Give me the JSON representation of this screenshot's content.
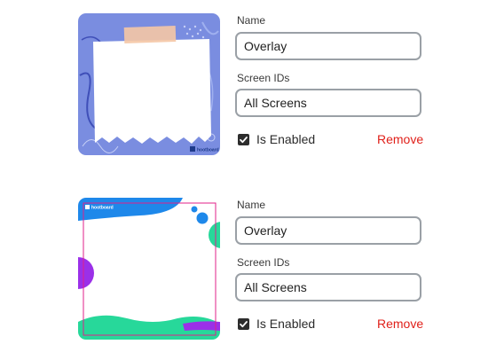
{
  "overlays": [
    {
      "thumbnail_brand": "hootboard",
      "name_label": "Name",
      "name_value": "Overlay",
      "screens_label": "Screen IDs",
      "screens_value": "All Screens",
      "enabled_label": "Is Enabled",
      "enabled": true,
      "remove_label": "Remove"
    },
    {
      "thumbnail_brand": "hootboard",
      "name_label": "Name",
      "name_value": "Overlay",
      "screens_label": "Screen IDs",
      "screens_value": "All Screens",
      "enabled_label": "Is Enabled",
      "enabled": true,
      "remove_label": "Remove"
    }
  ],
  "colors": {
    "remove": "#e0201a",
    "checkbox": "#2d2d2d",
    "thumb1_bg": "#7a8de0",
    "thumb2_blue": "#1e88ea",
    "thumb2_green": "#27d89a",
    "thumb2_purple": "#9b30e8",
    "thumb2_frame": "#e0208a"
  }
}
